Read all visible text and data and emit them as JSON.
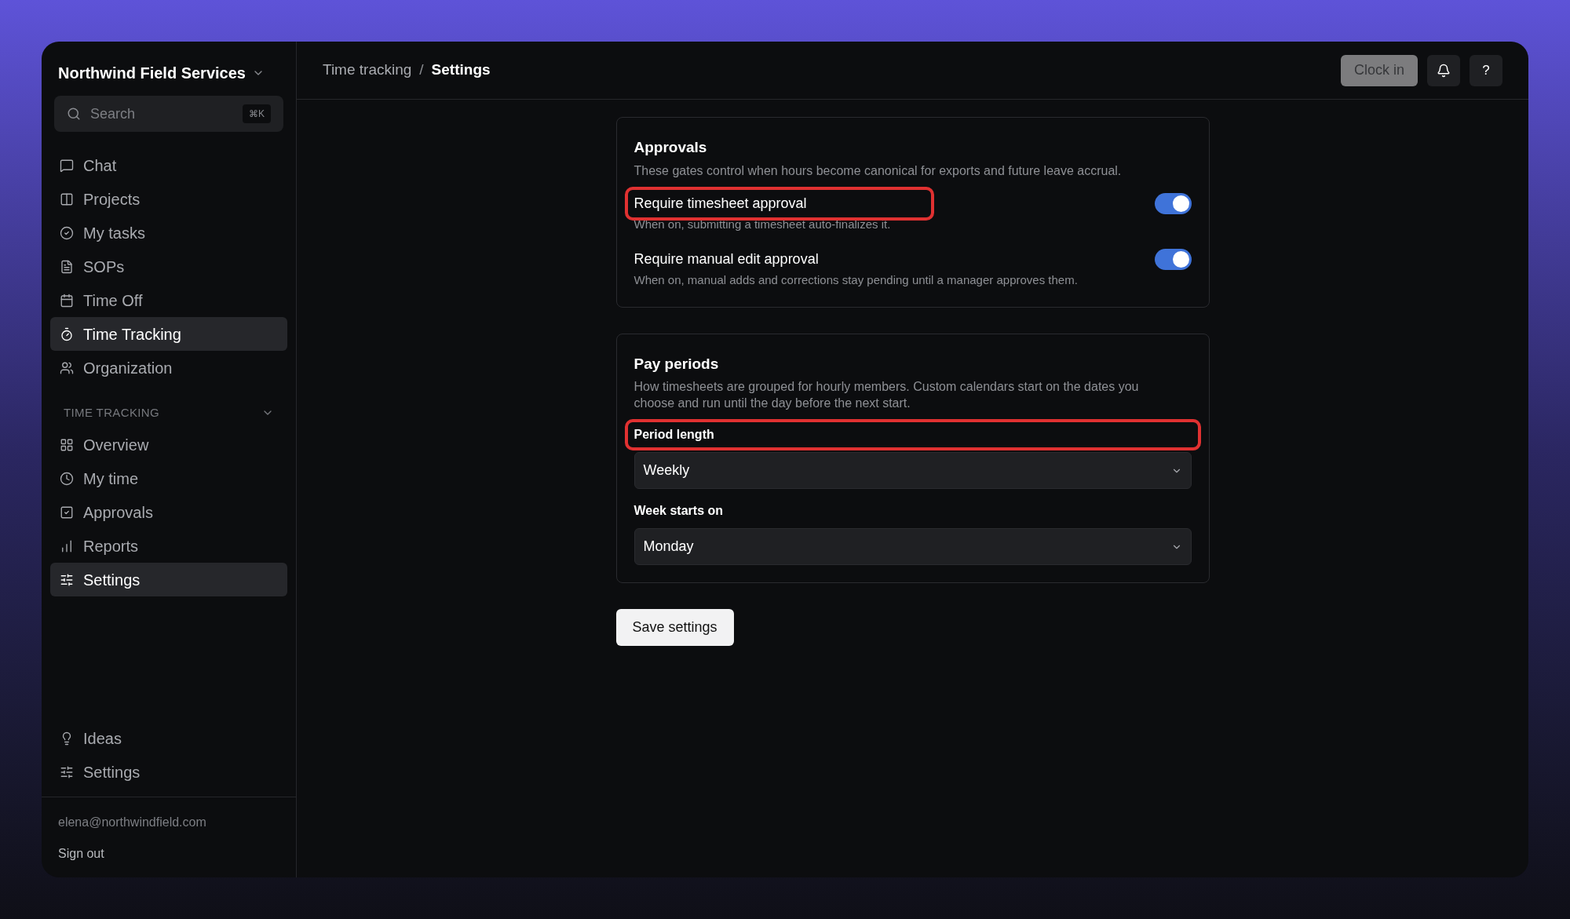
{
  "workspace": {
    "name": "Northwind Field Services"
  },
  "search": {
    "placeholder": "Search",
    "shortcut": "⌘K"
  },
  "nav": [
    {
      "label": "Chat",
      "selected": false
    },
    {
      "label": "Projects",
      "selected": false
    },
    {
      "label": "My tasks",
      "selected": false
    },
    {
      "label": "SOPs",
      "selected": false
    },
    {
      "label": "Time Off",
      "selected": false
    },
    {
      "label": "Time Tracking",
      "selected": true
    },
    {
      "label": "Organization",
      "selected": false
    }
  ],
  "section": {
    "title": "TIME TRACKING",
    "expanded": true,
    "items": [
      {
        "label": "Overview",
        "selected": false
      },
      {
        "label": "My time",
        "selected": false
      },
      {
        "label": "Approvals",
        "selected": false
      },
      {
        "label": "Reports",
        "selected": false
      },
      {
        "label": "Settings",
        "selected": true
      }
    ]
  },
  "footer_nav": [
    {
      "label": "Ideas",
      "selected": false
    },
    {
      "label": "Settings",
      "selected": false
    }
  ],
  "account": {
    "email": "elena@northwindfield.com",
    "sign_out": "Sign out"
  },
  "breadcrumb_separator": "/",
  "breadcrumb": [
    {
      "label": "Time tracking",
      "current": false
    },
    {
      "label": "Settings",
      "current": true
    }
  ],
  "header_actions": {
    "clock_in": {
      "label": "Clock in",
      "disabled": true
    },
    "help": "?"
  },
  "cards": [
    {
      "title": "Approvals",
      "description": "These gates control when hours become canonical for exports and future leave accrual.",
      "settings": [
        {
          "kind": "toggle",
          "label": "Require timesheet approval",
          "description": "When on, submitting a timesheet auto-finalizes it.",
          "on": true,
          "highlighted": true
        },
        {
          "kind": "toggle",
          "label": "Require manual edit approval",
          "description": "When on, manual adds and corrections stay pending until a manager approves them.",
          "on": true,
          "highlighted": false
        }
      ]
    },
    {
      "title": "Pay periods",
      "description": "How timesheets are grouped for hourly members. Custom calendars start on the dates you choose and run until the day before the next start.",
      "settings": [
        {
          "kind": "select",
          "label": "Period length",
          "value": "Weekly",
          "highlighted": true
        },
        {
          "kind": "select",
          "label": "Week starts on",
          "value": "Monday",
          "highlighted": false
        }
      ]
    }
  ],
  "save_button": "Save settings"
}
